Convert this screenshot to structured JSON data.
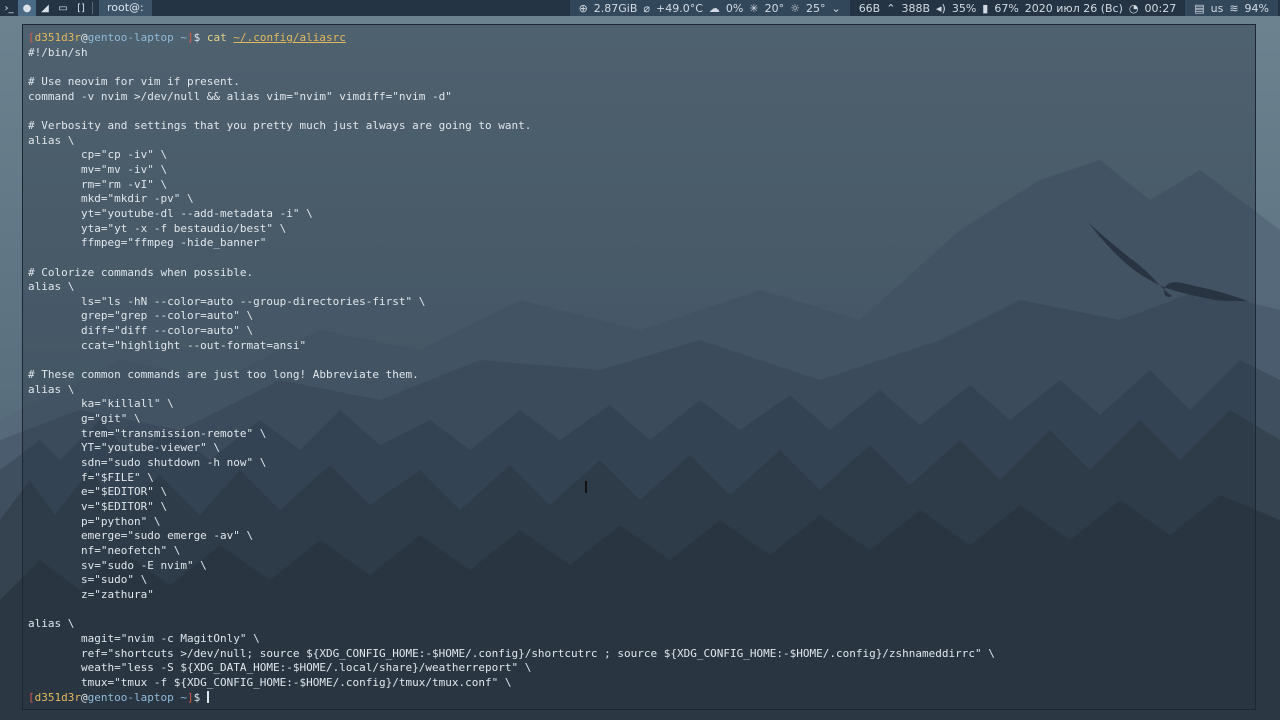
{
  "topbar": {
    "workspace_icons": [
      "terminal-icon",
      "gentoo-icon",
      "telegram-icon",
      "display-icon",
      "layout-icon"
    ],
    "window_title": "root@:",
    "status": {
      "memory": "2.87GiB",
      "temp": "+49.0°C",
      "cpu": "0%",
      "weather_icon_text": "20°",
      "weather_temp": "25°",
      "download": "66B",
      "upload": "388B",
      "volume": "35%",
      "battery": "67%",
      "date": "2020 июл 26 (Вс)",
      "time": "00:27",
      "keyboard": "us",
      "wifi": "94%"
    }
  },
  "terminal": {
    "prompt": {
      "bracket_open": "[",
      "user": "d351d3r",
      "at": "@",
      "host": "gentoo-laptop",
      "dir": " ~",
      "bracket_close": "]",
      "symbol": "$ "
    },
    "command": "cat",
    "argument": "~/.config/aliasrc",
    "output": [
      "#!/bin/sh",
      "",
      "# Use neovim for vim if present.",
      "command -v nvim >/dev/null && alias vim=\"nvim\" vimdiff=\"nvim -d\"",
      "",
      "# Verbosity and settings that you pretty much just always are going to want.",
      "alias \\",
      "        cp=\"cp -iv\" \\",
      "        mv=\"mv -iv\" \\",
      "        rm=\"rm -vI\" \\",
      "        mkd=\"mkdir -pv\" \\",
      "        yt=\"youtube-dl --add-metadata -i\" \\",
      "        yta=\"yt -x -f bestaudio/best\" \\",
      "        ffmpeg=\"ffmpeg -hide_banner\"",
      "",
      "# Colorize commands when possible.",
      "alias \\",
      "        ls=\"ls -hN --color=auto --group-directories-first\" \\",
      "        grep=\"grep --color=auto\" \\",
      "        diff=\"diff --color=auto\" \\",
      "        ccat=\"highlight --out-format=ansi\"",
      "",
      "# These common commands are just too long! Abbreviate them.",
      "alias \\",
      "        ka=\"killall\" \\",
      "        g=\"git\" \\",
      "        trem=\"transmission-remote\" \\",
      "        YT=\"youtube-viewer\" \\",
      "        sdn=\"sudo shutdown -h now\" \\",
      "        f=\"$FILE\" \\",
      "        e=\"$EDITOR\" \\",
      "        v=\"$EDITOR\" \\",
      "        p=\"python\" \\",
      "        emerge=\"sudo emerge -av\" \\",
      "        nf=\"neofetch\" \\",
      "        sv=\"sudo -E nvim\" \\",
      "        s=\"sudo\" \\",
      "        z=\"zathura\"",
      "",
      "alias \\",
      "        magit=\"nvim -c MagitOnly\" \\",
      "        ref=\"shortcuts >/dev/null; source ${XDG_CONFIG_HOME:-$HOME/.config}/shortcutrc ; source ${XDG_CONFIG_HOME:-$HOME/.config}/zshnameddirrc\" \\",
      "        weath=\"less -S ${XDG_DATA_HOME:-$HOME/.local/share}/weatherreport\" \\",
      "        tmux=\"tmux -f ${XDG_CONFIG_HOME:-$HOME/.config}/tmux/tmux.conf\" \\"
    ]
  }
}
